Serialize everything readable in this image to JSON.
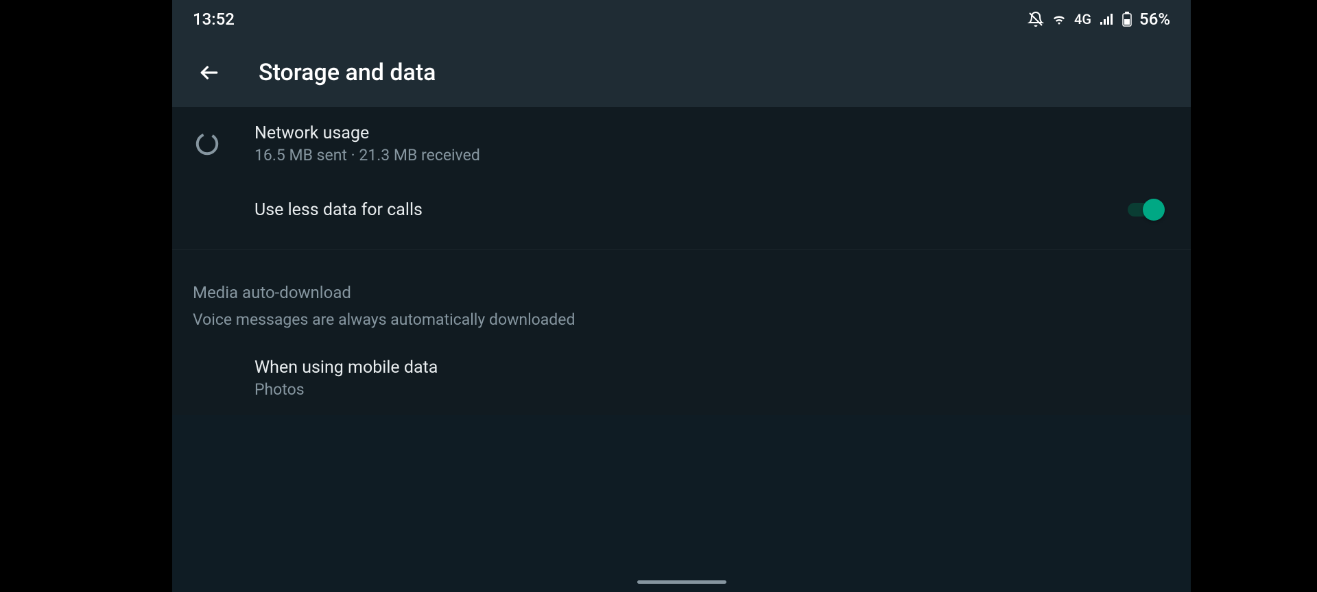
{
  "statusBar": {
    "time": "13:52",
    "networkType": "4G",
    "battery": "56%"
  },
  "appBar": {
    "title": "Storage and data"
  },
  "networkUsage": {
    "title": "Network usage",
    "subtitle": "16.5 MB sent · 21.3 MB received"
  },
  "useLessData": {
    "title": "Use less data for calls",
    "enabled": true
  },
  "mediaSection": {
    "title": "Media auto-download",
    "subtitle": "Voice messages are always automatically downloaded"
  },
  "mobileData": {
    "title": "When using mobile data",
    "subtitle": "Photos"
  }
}
